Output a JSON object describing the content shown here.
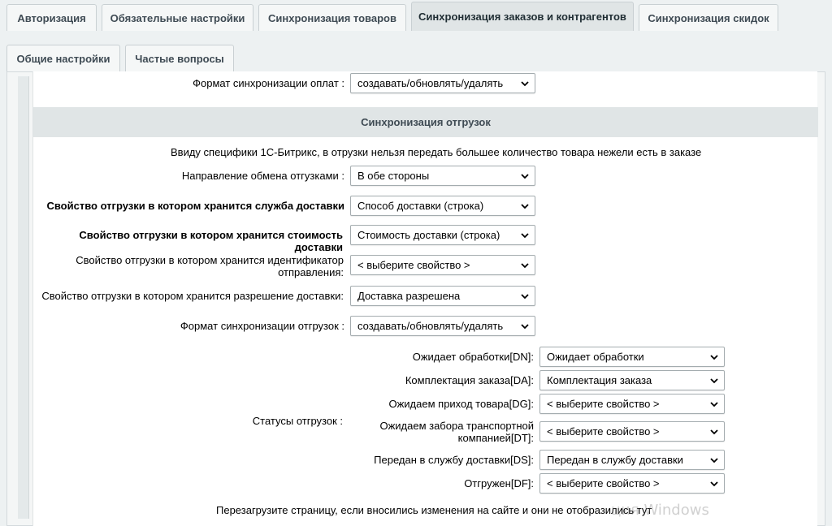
{
  "tabs_row1": [
    {
      "label": "Авторизация",
      "active": false
    },
    {
      "label": "Обязательные настройки",
      "active": false
    },
    {
      "label": "Синхронизация товаров",
      "active": false
    },
    {
      "label": "Синхронизация заказов и контрагентов",
      "active": true
    },
    {
      "label": "Синхронизация скидок",
      "active": false
    }
  ],
  "tabs_row2": [
    {
      "label": "Общие настройки"
    },
    {
      "label": "Частые вопросы"
    }
  ],
  "payments": {
    "format_label": "Формат синхронизации оплат :",
    "format_value": "создавать/обновлять/удалять"
  },
  "shipments": {
    "section_title": "Синхронизация отгрузок",
    "notice": "Ввиду специфики 1С-Битрикс, в отрузки нельзя передать большее количество товара нежели есть в заказе",
    "direction_label": "Направление обмена отгузками :",
    "direction_value": "В обе стороны",
    "delivery_service_label": "Свойство отгрузки в котором хранится служба доставки",
    "delivery_service_value": "Способ доставки (строка)",
    "delivery_cost_label": "Свойство отгрузки в котором хранится стоимость доставки",
    "delivery_cost_value": "Стоимость доставки (строка)",
    "tracking_label_line1": "Свойство отгрузки в котором хранится идентификатор",
    "tracking_label_line2": "отправления:",
    "tracking_value": "< выберите свойство >",
    "permission_label": "Свойство отгрузки в котором хранится разрешение доставки:",
    "permission_value": "Доставка разрешена",
    "format_label": "Формат синхронизации отгрузок :",
    "format_value": "создавать/обновлять/удалять",
    "statuses_label": "Статусы отгрузок :",
    "statuses": [
      {
        "label": "Ожидает обработки[DN]:",
        "value": "Ожидает обработки"
      },
      {
        "label": "Комплектация заказа[DA]:",
        "value": "Комплектация заказа"
      },
      {
        "label": "Ожидаем приход товара[DG]:",
        "value": "< выберите свойство >"
      },
      {
        "label_line1": "Ожидаем забора транспортной",
        "label_line2": "компанией[DT]:",
        "value": "< выберите свойство >"
      },
      {
        "label": "Передан в службу доставки[DS]:",
        "value": "Передан в службу доставки"
      },
      {
        "label": "Отгружен[DF]:",
        "value": "< выберите свойство >"
      }
    ],
    "reload_notice": "Перезагрузите страницу, если вносились изменения на сайте и они не отобразились тут"
  },
  "watermark_text": "ция Windows",
  "colors": {
    "page_bg": "#edf1f2",
    "tab_active_bg": "#e0e5e6",
    "section_header_bg": "#e0e5e6",
    "select_border": "#a4acaf"
  }
}
